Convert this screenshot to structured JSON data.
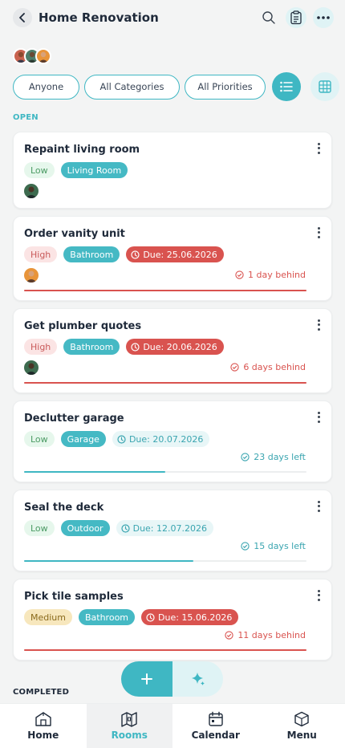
{
  "header": {
    "title": "Home Renovation"
  },
  "filters": {
    "assignee": "Anyone",
    "category": "All Categories",
    "priority": "All Priorities"
  },
  "sections": {
    "open": "OPEN",
    "completed": "COMPLETED"
  },
  "colors": {
    "accent": "#3fb7c3",
    "overdue": "#d9534f",
    "low_bg": "#e6f7ec",
    "high_bg": "#fbe4e4",
    "medium_bg": "#f7e7bd"
  },
  "tasks": [
    {
      "title": "Repaint living room",
      "priority": "Low",
      "room": "Living Room",
      "due": "",
      "status": "",
      "progress": null
    },
    {
      "title": "Order vanity unit",
      "priority": "High",
      "room": "Bathroom",
      "due": "Due: 25.06.2026",
      "status": "1 day behind",
      "progress": 1.0
    },
    {
      "title": "Get plumber quotes",
      "priority": "High",
      "room": "Bathroom",
      "due": "Due: 20.06.2026",
      "status": "6 days behind",
      "progress": 1.0
    },
    {
      "title": "Declutter garage",
      "priority": "Low",
      "room": "Garage",
      "due": "Due: 20.07.2026",
      "status": "23 days left",
      "progress": 0.5
    },
    {
      "title": "Seal the deck",
      "priority": "Low",
      "room": "Outdoor",
      "due": "Due: 12.07.2026",
      "status": "15 days left",
      "progress": 0.6
    },
    {
      "title": "Pick tile samples",
      "priority": "Medium",
      "room": "Bathroom",
      "due": "Due: 15.06.2026",
      "status": "11 days behind",
      "progress": 1.0
    }
  ],
  "nav": {
    "home": "Home",
    "rooms": "Rooms",
    "calendar": "Calendar",
    "menu": "Menu"
  },
  "icons": [
    "back-icon",
    "search-icon",
    "clipboard-icon",
    "more-icon",
    "list-view-icon",
    "grid-view-icon",
    "clock-icon",
    "plus-icon",
    "sparkle-icon",
    "house-icon",
    "rooms-icon",
    "calendar-icon",
    "cube-icon"
  ]
}
